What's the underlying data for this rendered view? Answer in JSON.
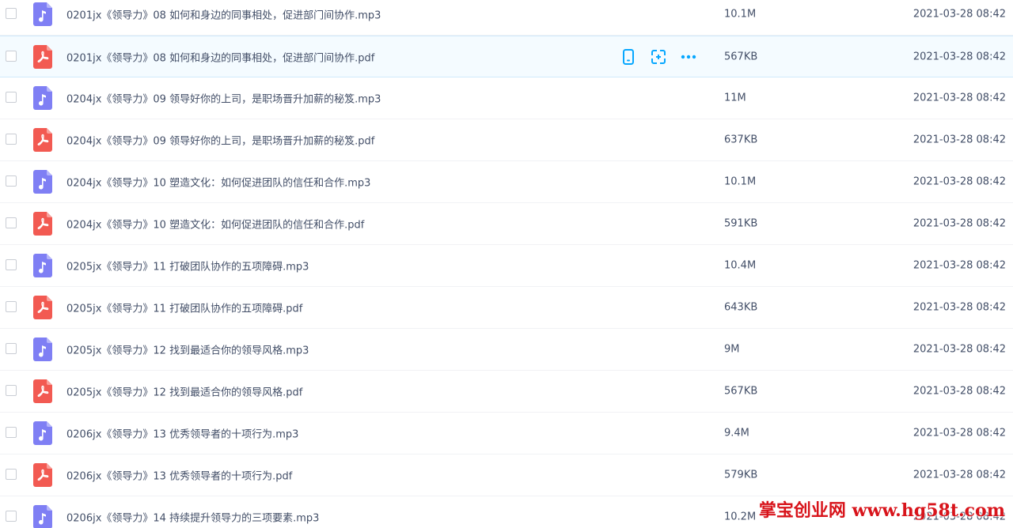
{
  "files": [
    {
      "name": "0201jx《领导力》08 如何和身边的同事相处，促进部门间协作.mp3",
      "type": "mp3",
      "size": "10.1M",
      "date": "2021-03-28 08:42"
    },
    {
      "name": "0201jx《领导力》08 如何和身边的同事相处，促进部门间协作.pdf",
      "type": "pdf",
      "size": "567KB",
      "date": "2021-03-28 08:42",
      "hovered": true
    },
    {
      "name": "0204jx《领导力》09 领导好你的上司，是职场晋升加薪的秘笈.mp3",
      "type": "mp3",
      "size": "11M",
      "date": "2021-03-28 08:42"
    },
    {
      "name": "0204jx《领导力》09 领导好你的上司，是职场晋升加薪的秘笈.pdf",
      "type": "pdf",
      "size": "637KB",
      "date": "2021-03-28 08:42"
    },
    {
      "name": "0204jx《领导力》10 塑造文化：如何促进团队的信任和合作.mp3",
      "type": "mp3",
      "size": "10.1M",
      "date": "2021-03-28 08:42"
    },
    {
      "name": "0204jx《领导力》10 塑造文化：如何促进团队的信任和合作.pdf",
      "type": "pdf",
      "size": "591KB",
      "date": "2021-03-28 08:42"
    },
    {
      "name": "0205jx《领导力》11 打破团队协作的五项障碍.mp3",
      "type": "mp3",
      "size": "10.4M",
      "date": "2021-03-28 08:42"
    },
    {
      "name": "0205jx《领导力》11 打破团队协作的五项障碍.pdf",
      "type": "pdf",
      "size": "643KB",
      "date": "2021-03-28 08:42"
    },
    {
      "name": "0205jx《领导力》12 找到最适合你的领导风格.mp3",
      "type": "mp3",
      "size": "9M",
      "date": "2021-03-28 08:42"
    },
    {
      "name": "0205jx《领导力》12 找到最适合你的领导风格.pdf",
      "type": "pdf",
      "size": "567KB",
      "date": "2021-03-28 08:42"
    },
    {
      "name": "0206jx《领导力》13 优秀领导者的十项行为.mp3",
      "type": "mp3",
      "size": "9.4M",
      "date": "2021-03-28 08:42"
    },
    {
      "name": "0206jx《领导力》13 优秀领导者的十项行为.pdf",
      "type": "pdf",
      "size": "579KB",
      "date": "2021-03-28 08:42"
    },
    {
      "name": "0206jx《领导力》14 持续提升领导力的三项要素.mp3",
      "type": "mp3",
      "size": "10.2M",
      "date": "2021-03-28 08:42"
    }
  ],
  "row_actions": [
    "phone-icon",
    "share-link-icon",
    "more-icon"
  ],
  "watermark": "掌宝创业网 www.hg58t.com",
  "colors": {
    "mp3_icon": "#7f7ff4",
    "pdf_icon": "#f25a52",
    "action_blue": "#06a7ff",
    "text": "#424e67",
    "hover_bg": "#f4fbff",
    "watermark": "#d8141b"
  }
}
